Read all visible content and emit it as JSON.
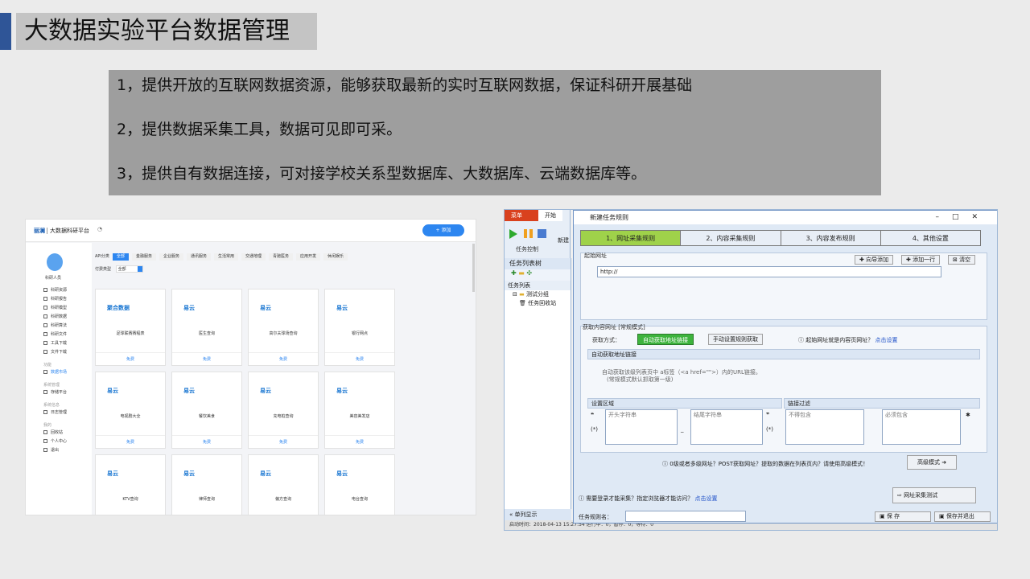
{
  "slide": {
    "title": "大数据实验平台数据管理",
    "points": [
      "1，提供开放的互联网数据资源，能够获取最新的实时互联网数据，保证科研开展基础",
      "2，提供数据采集工具，数据可见即可采。",
      "3，提供自有数据连接，可对接学校关系型数据库、大数据库、云端数据库等。"
    ]
  },
  "left_app": {
    "logo": "丽澜",
    "platform_name": "大数据科研平台",
    "add_button": "+ 添加",
    "user_name": "科研人员",
    "nav": [
      {
        "label": "科研资源",
        "type": "item"
      },
      {
        "label": "科研报告",
        "type": "item"
      },
      {
        "label": "科研模型",
        "type": "item"
      },
      {
        "label": "科研数据",
        "type": "item"
      },
      {
        "label": "科研算法",
        "type": "item"
      },
      {
        "label": "科研文件",
        "type": "item"
      },
      {
        "label": "工具下载",
        "type": "item"
      },
      {
        "label": "文件下载",
        "type": "item"
      },
      {
        "label": "功能",
        "type": "section"
      },
      {
        "label": "数据市场",
        "type": "active"
      },
      {
        "label": "系统管理",
        "type": "section"
      },
      {
        "label": "存储平台",
        "type": "item"
      },
      {
        "label": "系统信息",
        "type": "section"
      },
      {
        "label": "日志管理",
        "type": "item"
      },
      {
        "label": "我的",
        "type": "section"
      },
      {
        "label": "回收站",
        "type": "item"
      },
      {
        "label": "个人中心",
        "type": "item"
      },
      {
        "label": "退出",
        "type": "item"
      }
    ],
    "filter_label": "API分类",
    "filters": [
      "全部",
      "金融服务",
      "企业服务",
      "通讯服务",
      "生活常用",
      "交通地理",
      "青驰医务",
      "应用开发",
      "休闲娱乐"
    ],
    "type_label": "付费类型",
    "type_value": "全部",
    "cards": [
      {
        "brand": "聚合数据",
        "name": "足球联赛赛程表",
        "price": "免费"
      },
      {
        "brand": "易云",
        "name": "医生查询",
        "price": "免费"
      },
      {
        "brand": "易云",
        "name": "高尔夫球场查询",
        "price": "免费"
      },
      {
        "brand": "易云",
        "name": "银行网点",
        "price": "免费"
      },
      {
        "brand": "易云",
        "name": "电视剧大全",
        "price": "免费"
      },
      {
        "brand": "易云",
        "name": "餐饮美食",
        "price": "免费"
      },
      {
        "brand": "易云",
        "name": "充电桩查询",
        "price": "免费"
      },
      {
        "brand": "易云",
        "name": "美容美发店",
        "price": "免费"
      },
      {
        "brand": "易云",
        "name": "KTV查询",
        "price": ""
      },
      {
        "brand": "易云",
        "name": "律师查询",
        "price": ""
      },
      {
        "brand": "易云",
        "name": "偏方查询",
        "price": ""
      },
      {
        "brand": "易云",
        "name": "电台查询",
        "price": ""
      }
    ]
  },
  "right_app": {
    "menu_tab": "菜单",
    "start_tab": "开始",
    "new_label": "新建",
    "task_control": "任务控制",
    "tree_title": "任务列表树",
    "task_list": "任务列表",
    "tree_nodes": [
      "测试分组",
      "任务回收站"
    ],
    "single_show": "单列显示",
    "status_text": "启动时间：2018-04-13 15:27:54     运行中：0，暂停：0，等待：0",
    "dialog": {
      "title": "新建任务规则",
      "steps": [
        "1、网址采集规则",
        "2、内容采集规则",
        "3、内容发布规则",
        "4、其他设置"
      ],
      "start_url_label": "起始网址",
      "wizard_add": "向导添加",
      "add_row": "添加一行",
      "clear": "清空",
      "url_value": "http://",
      "fetch_title": "获取内容网址 [常规模式]",
      "fetch_method": "获取方式：",
      "auto_btn": "自动获取地址链接",
      "manual_btn": "手动设置规则获取",
      "start_is_content": "起始网址就是内容页网址？",
      "click_setting": "点击设置",
      "auto_section": "自动获取地址链接",
      "auto_hint": "自动获取该级列表页中 a标签（<a href=\"\">）内的URL链接。",
      "auto_hint2": "(常规模式默认抓取第一级)",
      "area_label": "设置区域",
      "link_filter": "链接过滤",
      "begin_str": "开头字符串",
      "end_str": "结尾字符串",
      "no_contain": "不得包含",
      "must_contain": "必须包含",
      "multi_hint": "0级或者多级网址？POST获取网址？提取的数据在列表页内？请使用高级模式！",
      "advanced": "高级模式",
      "login_hint": "需要登录才能采集？指定浏览器才能访问？",
      "login_link": "点击设置",
      "test_btn": "网址采集测试",
      "rule_name": "任务规则名：",
      "save": "保 存",
      "save_exit": "保存并退出"
    }
  }
}
